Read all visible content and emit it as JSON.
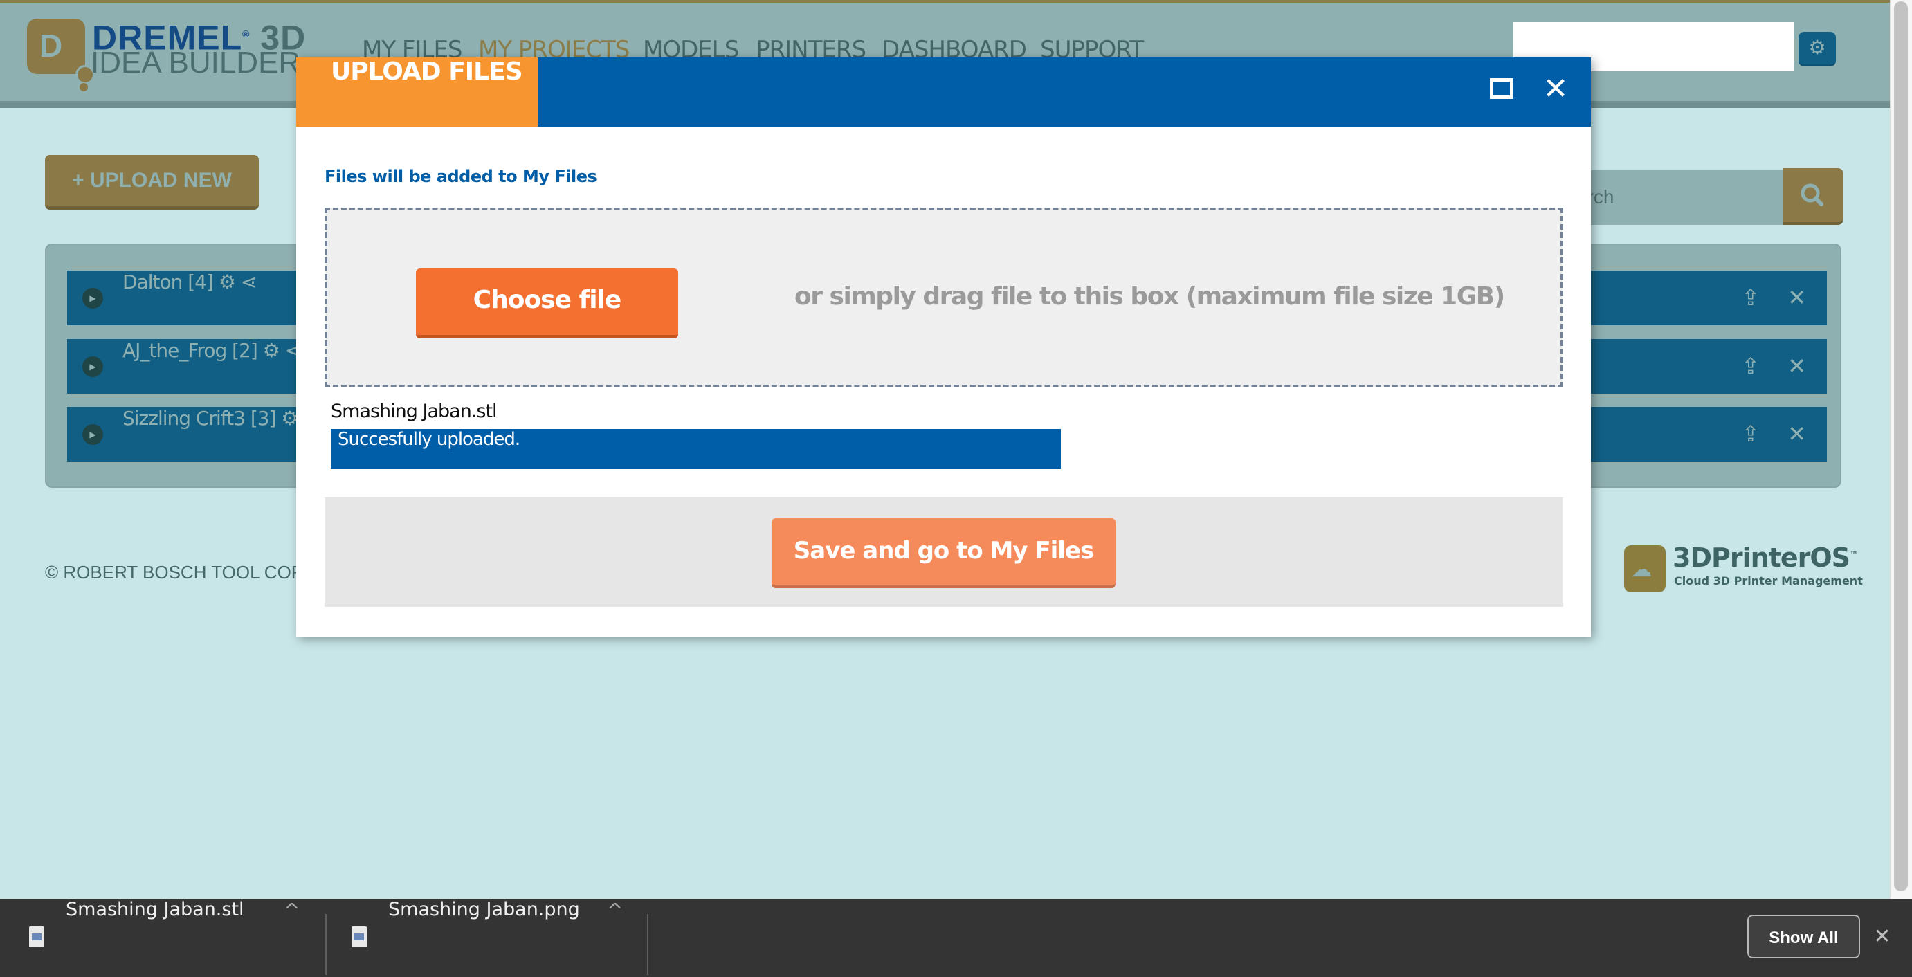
{
  "app": {
    "logo": {
      "brand_top": "DREMEL",
      "brand_3d": "3D",
      "brand_bottom": "IDEA BUILDER",
      "mark_letter": "D"
    },
    "nav": [
      {
        "label": "MY FILES",
        "active": false
      },
      {
        "label": "MY PROJECTS",
        "active": true
      },
      {
        "label": "MODELS",
        "active": false
      },
      {
        "label": "PRINTERS",
        "active": false
      },
      {
        "label": "DASHBOARD",
        "active": false
      },
      {
        "label": "SUPPORT",
        "active": false
      }
    ],
    "settings_icon": "gear-icon"
  },
  "main": {
    "upload_new_label": "+ UPLOAD NEW",
    "search": {
      "placeholder": "Search",
      "visible_text": "arch",
      "icon": "search-icon"
    },
    "projects": [
      {
        "name": "Dalton [4]",
        "icons": [
          "gears-icon",
          "share-icon"
        ]
      },
      {
        "name": "AJ_the_Frog [2]",
        "icons": [
          "gears-icon",
          "share-icon"
        ]
      },
      {
        "name": "Sizzling Crift3 [3]",
        "icons": [
          "gears-icon",
          "share-icon"
        ]
      }
    ],
    "row_actions": {
      "upload_icon": "upload-icon",
      "delete_icon": "close-icon"
    }
  },
  "footer": {
    "copyright": "© ROBERT BOSCH TOOL CORPORA",
    "partner_logo": {
      "name": "3DPrinterOS",
      "trademark": "™",
      "tagline": "Cloud 3D Printer Management"
    }
  },
  "modal": {
    "title": "UPLOAD FILES",
    "maximize_icon": "maximize-icon",
    "close_icon": "close-icon",
    "note": "Files will be added to My Files",
    "choose_file_label": "Choose file",
    "drag_text": "or simply drag file to this box (maximum file size 1GB)",
    "uploads": [
      {
        "file_name": "Smashing Jaban.stl",
        "status": "Succesfully uploaded.",
        "progress_percent": 100
      }
    ],
    "save_label": "Save and go to My Files",
    "colors": {
      "title_tab": "#f79530",
      "header": "#005ea8",
      "choose_file": "#f47030",
      "save": "#f58a5b"
    }
  },
  "download_bar": {
    "items": [
      {
        "name": "Smashing Jaban.stl",
        "type": "STL"
      },
      {
        "name": "Smashing Jaban.png",
        "type": "PNG"
      }
    ],
    "show_all_label": "Show All",
    "close_icon": "close-icon"
  }
}
